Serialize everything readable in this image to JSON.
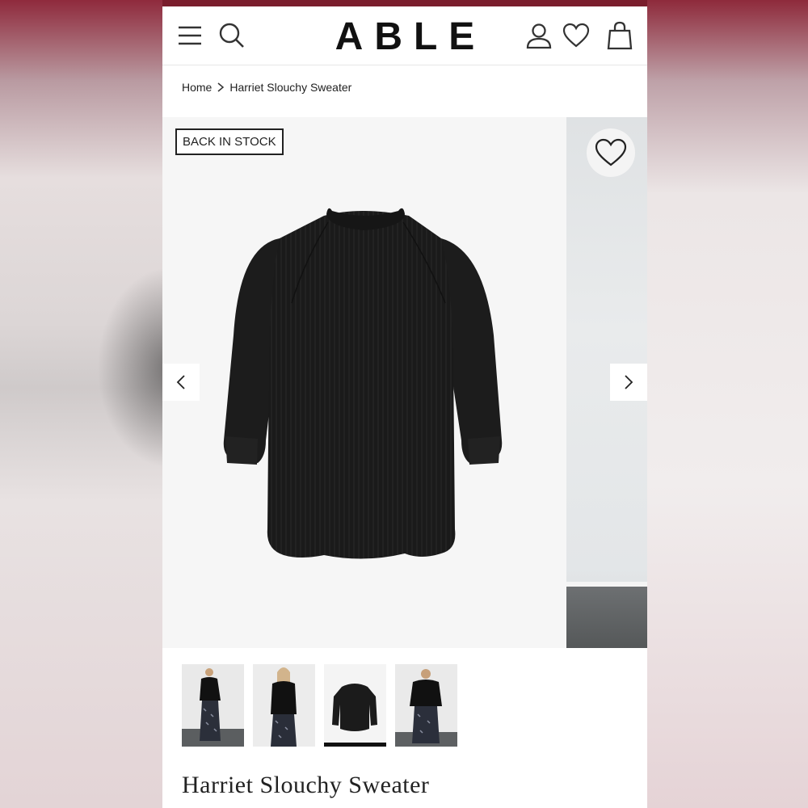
{
  "header": {
    "logo": "ABLE",
    "brand_color": "#7a1d2c",
    "icons": [
      "menu-icon",
      "search-icon",
      "account-icon",
      "heart-icon",
      "bag-icon"
    ]
  },
  "breadcrumb": {
    "home": "Home",
    "current": "Harriet Slouchy Sweater"
  },
  "gallery": {
    "badge": "BACK IN STOCK",
    "thumbnails": [
      {
        "name": "thumb-model-front",
        "selected": false
      },
      {
        "name": "thumb-model-back",
        "selected": false
      },
      {
        "name": "thumb-product-flat",
        "selected": true
      },
      {
        "name": "thumb-model-side",
        "selected": false
      }
    ]
  },
  "product": {
    "title": "Harriet Slouchy Sweater"
  }
}
